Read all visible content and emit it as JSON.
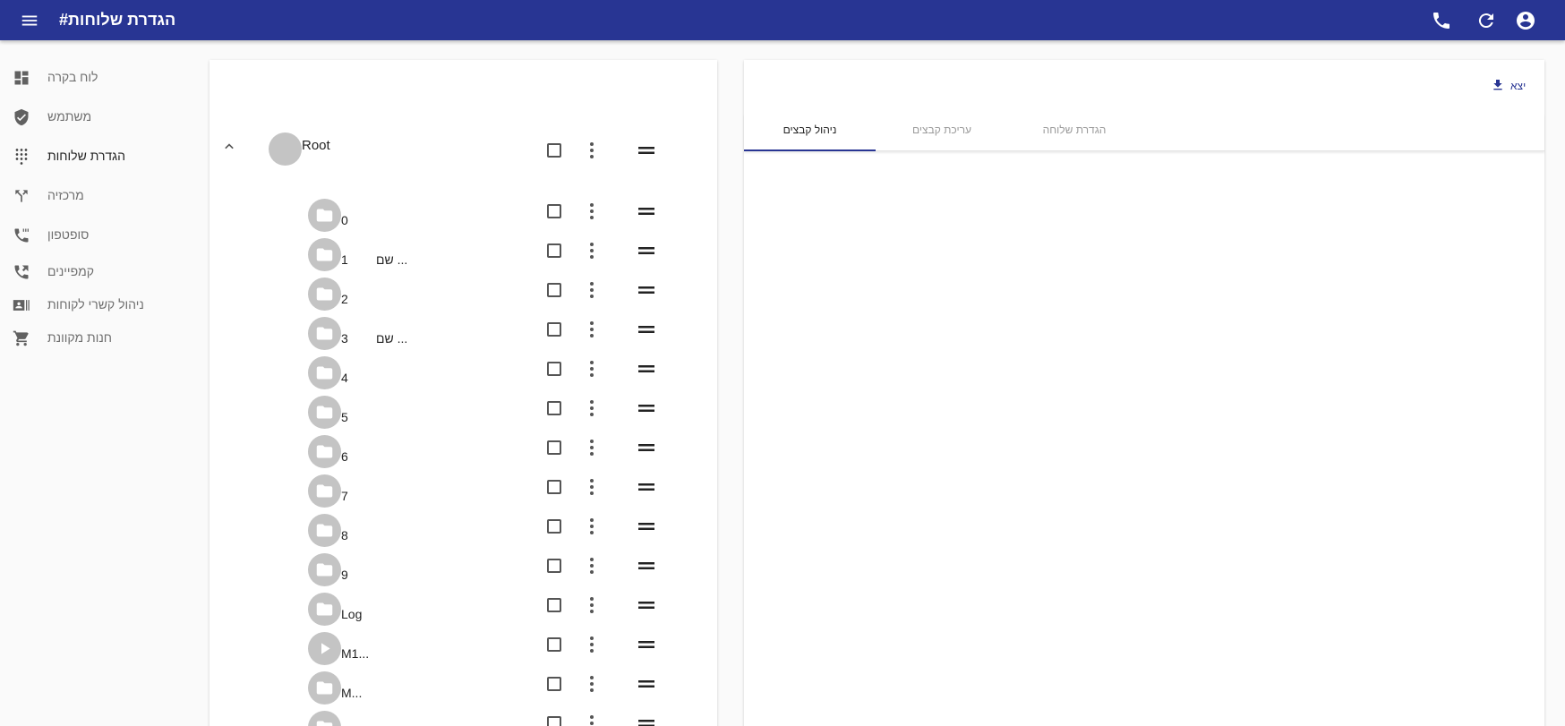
{
  "appbar": {
    "title": "הגדרת שלוחות#",
    "menu_icon": "menu-icon",
    "phone_icon": "phone-icon",
    "refresh_icon": "refresh-icon",
    "account_icon": "account-circle-icon",
    "background": "#283593"
  },
  "sidebar": {
    "items": [
      {
        "label": "לוח בקרה",
        "icon": "dashboard-icon"
      },
      {
        "label": "משתמש",
        "icon": "shield-check-icon"
      },
      {
        "label": "הגדרת שלוחות",
        "icon": "dialpad-icon",
        "active": true
      },
      {
        "label": "מרכזיה",
        "icon": "call-split-icon"
      },
      {
        "label": "סופטפון",
        "icon": "phone-dialing-icon"
      },
      {
        "label": "קמפיינים",
        "icon": "phone-forward-icon"
      },
      {
        "label": "ניהול קשרי לקוחות",
        "icon": "contacts-icon"
      },
      {
        "label": "חנות מקוונת",
        "icon": "cart-icon"
      }
    ]
  },
  "tree": {
    "root_label": "Root",
    "nodes": [
      {
        "label": "0",
        "desc": "",
        "type": "folder"
      },
      {
        "label": "1",
        "desc": "שם ...",
        "type": "folder"
      },
      {
        "label": "2",
        "desc": "",
        "type": "folder"
      },
      {
        "label": "3",
        "desc": "שם ...",
        "type": "folder"
      },
      {
        "label": "4",
        "desc": "",
        "type": "folder"
      },
      {
        "label": "5",
        "desc": "",
        "type": "folder"
      },
      {
        "label": "6",
        "desc": "",
        "type": "folder"
      },
      {
        "label": "7",
        "desc": "",
        "type": "folder"
      },
      {
        "label": "8",
        "desc": "",
        "type": "folder"
      },
      {
        "label": "9",
        "desc": "",
        "type": "folder"
      },
      {
        "label": "Log",
        "desc": "",
        "type": "folder"
      },
      {
        "label": "M1...",
        "desc": "",
        "type": "play"
      },
      {
        "label": "M...",
        "desc": "",
        "type": "folder"
      },
      {
        "label": "",
        "desc": "",
        "type": "folder"
      }
    ]
  },
  "right_panel": {
    "export_label": "יצא",
    "export_icon": "download-icon",
    "tabs": [
      {
        "label": "ניהול קבצים",
        "active": true
      },
      {
        "label": "עריכת קבצים",
        "active": false
      },
      {
        "label": "הגדרת שלוחה",
        "active": false
      }
    ],
    "accent": "#283593"
  }
}
